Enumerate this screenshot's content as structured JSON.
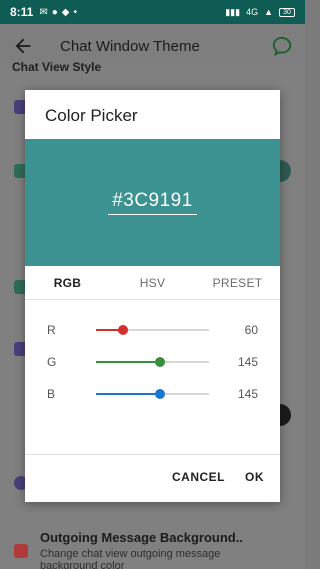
{
  "status_bar": {
    "time": "8:11",
    "network": "4G",
    "battery": "30"
  },
  "toolbar": {
    "title": "Chat Window Theme"
  },
  "background": {
    "section_label": "Chat View Style",
    "row_title": "Outgoing Message Background..",
    "row_subtitle": "Change chat view outgoing message background color"
  },
  "dialog": {
    "title": "Color Picker",
    "hex": "#3C9191",
    "preview_color": "#3C9191",
    "tabs": [
      {
        "label": "RGB",
        "active": true
      },
      {
        "label": "HSV",
        "active": false
      },
      {
        "label": "PRESET",
        "active": false
      }
    ],
    "sliders": [
      {
        "label": "R",
        "value": 60,
        "max": 255,
        "color": "#d32f2f"
      },
      {
        "label": "G",
        "value": 145,
        "max": 255,
        "color": "#388e3c"
      },
      {
        "label": "B",
        "value": 145,
        "max": 255,
        "color": "#1976d2"
      }
    ],
    "cancel_label": "CANCEL",
    "ok_label": "OK"
  }
}
